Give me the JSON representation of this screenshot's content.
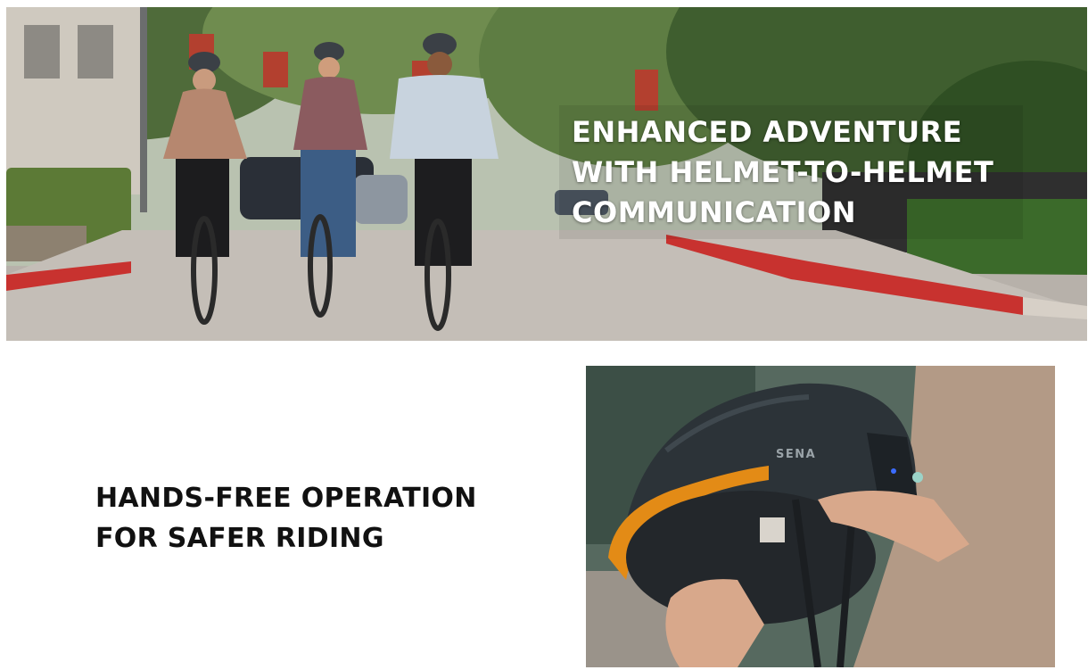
{
  "hero": {
    "headline_lines": [
      "ENHANCED ADVENTURE",
      "WITH HELMET-TO-HELMET",
      "COMMUNICATION"
    ],
    "image_subject": "three-riders-cycling-photo"
  },
  "feature": {
    "heading_lines": [
      "HANDS-FREE OPERATION",
      "FOR SAFER RIDING"
    ],
    "image_subject": "helmet-in-hands-photo",
    "helmet_brand": "SENA"
  },
  "colors": {
    "headline_on_photo": "#ffffff",
    "heading_text": "#111111",
    "background": "#ffffff",
    "curb_red": "#c8322f",
    "helmet_dark": "#2c3338",
    "visor_amber": "#e38b16"
  }
}
